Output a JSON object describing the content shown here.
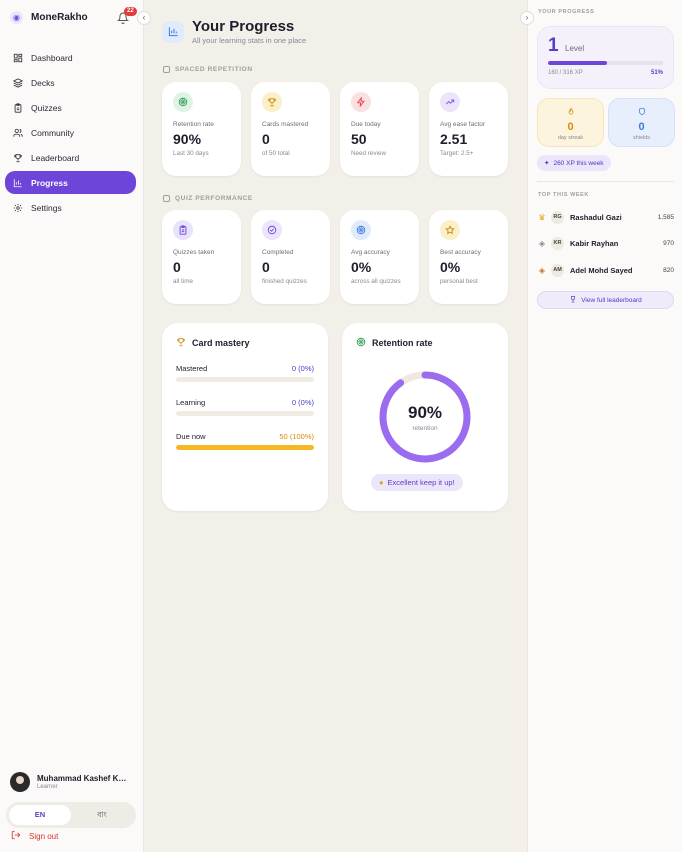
{
  "app": {
    "brand": "MoneRakho",
    "notification_count": "22"
  },
  "sidebar": {
    "items": [
      {
        "label": "Dashboard",
        "icon": "dashboard-icon"
      },
      {
        "label": "Decks",
        "icon": "layers-icon"
      },
      {
        "label": "Quizzes",
        "icon": "clipboard-icon"
      },
      {
        "label": "Community",
        "icon": "users-icon"
      },
      {
        "label": "Leaderboard",
        "icon": "trophy-icon"
      },
      {
        "label": "Progress",
        "icon": "bar-chart-icon",
        "active": true
      },
      {
        "label": "Settings",
        "icon": "gear-icon"
      }
    ],
    "user": {
      "name": "Muhammad Kashef Ka...",
      "role": "Learner"
    },
    "languages": [
      "EN",
      "বাং"
    ],
    "active_language": "EN",
    "signout_label": "Sign out"
  },
  "page": {
    "title": "Your Progress",
    "subtitle": "All your learning stats in one place"
  },
  "spaced_repetition": {
    "label": "SPACED REPETITION",
    "cards": [
      {
        "label": "Retention rate",
        "value": "90%",
        "sub": "Last 30 days",
        "icon": "target-icon",
        "color": "#2f9e54",
        "bg": "#dff3e5"
      },
      {
        "label": "Cards mastered",
        "value": "0",
        "sub": "of 50 total",
        "icon": "trophy-icon",
        "color": "#c98a0b",
        "bg": "#fbefc9"
      },
      {
        "label": "Due today",
        "value": "50",
        "sub": "Need review",
        "icon": "lightning-icon",
        "color": "#e0464d",
        "bg": "#fbe0e0"
      },
      {
        "label": "Avg ease factor",
        "value": "2.51",
        "sub": "Target: 2.5+",
        "icon": "trend-up-icon",
        "color": "#7a4fe0",
        "bg": "#ece4fb"
      }
    ]
  },
  "quiz_performance": {
    "label": "QUIZ PERFORMANCE",
    "cards": [
      {
        "label": "Quizzes taken",
        "value": "0",
        "sub": "all time",
        "icon": "clipboard-icon",
        "color": "#6d45d9",
        "bg": "#e9e2fb"
      },
      {
        "label": "Completed",
        "value": "0",
        "sub": "finished quizzes",
        "icon": "check-circle-icon",
        "color": "#6d45d9",
        "bg": "#ece4fb"
      },
      {
        "label": "Avg accuracy",
        "value": "0%",
        "sub": "across all quizzes",
        "icon": "target-icon",
        "color": "#3b7be0",
        "bg": "#dfeafb"
      },
      {
        "label": "Best accuracy",
        "value": "0%",
        "sub": "personal best",
        "icon": "star-icon",
        "color": "#c98a0b",
        "bg": "#fbefc9"
      }
    ]
  },
  "card_mastery": {
    "title": "Card mastery",
    "rows": [
      {
        "label": "Mastered",
        "value": "0 (0%)",
        "fraction": 0,
        "color": "#6d45d9"
      },
      {
        "label": "Learning",
        "value": "0 (0%)",
        "fraction": 0,
        "color": "#6d45d9"
      },
      {
        "label": "Due now",
        "value": "50 (100%)",
        "fraction": 1,
        "color": "#f5b820"
      }
    ]
  },
  "retention": {
    "title": "Retention rate",
    "value": "90%",
    "fraction": 0.9,
    "sub": "retention",
    "message": "Excellent keep it up!"
  },
  "right_panel": {
    "label": "YOUR PROGRESS",
    "level": "1",
    "level_word": "Level",
    "xp_text": "160 / 316 XP",
    "xp_percent": "51%",
    "xp_fraction": 0.51,
    "streak": {
      "value": "0",
      "label": "day streak"
    },
    "shields": {
      "value": "0",
      "label": "shields"
    },
    "xp_week": "260 XP this week",
    "top_label": "TOP THIS WEEK",
    "leaders": [
      {
        "initials": "RG",
        "name": "Rashadul Gazi",
        "points": "1,585",
        "medal": "crown-icon"
      },
      {
        "initials": "KR",
        "name": "Kabir Rayhan",
        "points": "970",
        "medal": "medal-silver-icon"
      },
      {
        "initials": "AM",
        "name": "Adel Mohd Sayed",
        "points": "820",
        "medal": "medal-bronze-icon"
      }
    ],
    "view_all": "View full leaderboard"
  },
  "colors": {
    "accent": "#6d45d9",
    "background": "#f3efe9",
    "warning": "#f5b820"
  }
}
